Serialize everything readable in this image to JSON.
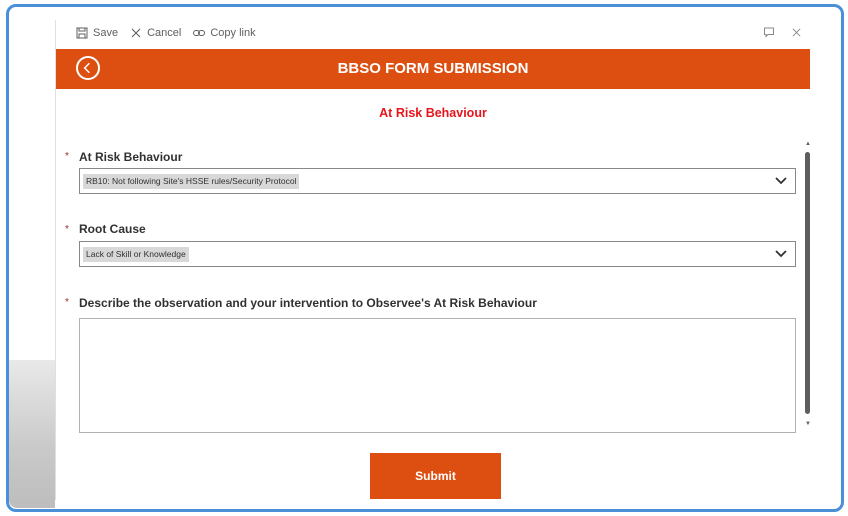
{
  "toolbar": {
    "save_label": "Save",
    "cancel_label": "Cancel",
    "copy_link_label": "Copy link"
  },
  "header": {
    "title": "BBSO FORM SUBMISSION",
    "color": "#dd4e11"
  },
  "section": {
    "title": "At Risk Behaviour",
    "color": "#e8141b"
  },
  "fields": {
    "at_risk_behaviour": {
      "label": "At Risk Behaviour",
      "required_marker": "*",
      "value": "RB10: Not following Site's HSSE rules/Security Protocol"
    },
    "root_cause": {
      "label": "Root Cause",
      "required_marker": "*",
      "value": "Lack of Skill or Knowledge"
    },
    "description": {
      "label": "Describe the observation and your intervention to Observee's At Risk Behaviour",
      "required_marker": "*",
      "value": ""
    }
  },
  "submit_label": "Submit",
  "icons": {
    "save": "save-icon",
    "cancel": "close-icon",
    "copy_link": "link-icon",
    "chat": "chat-icon",
    "close": "close-icon",
    "back": "back-arrow-icon",
    "dropdown": "chevron-down-icon"
  },
  "frame_color": "#4a90d9"
}
